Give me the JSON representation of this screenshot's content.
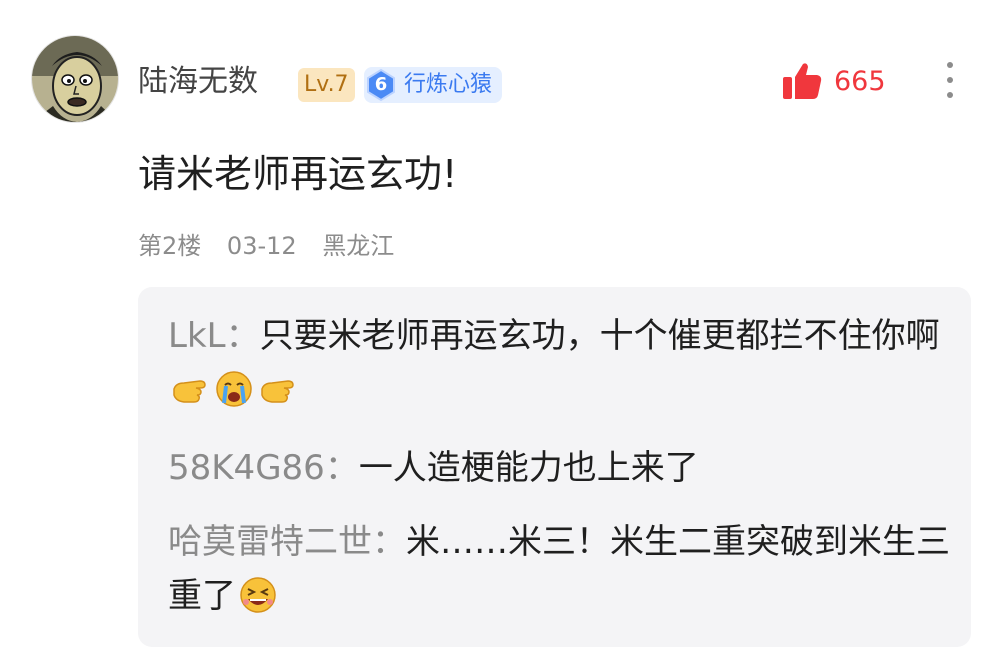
{
  "post": {
    "username": "陆海无数",
    "level": "Lv.7",
    "rank_number": "6",
    "rank_title": "行炼心猿",
    "like_count": "665",
    "comment_text": "请米老师再运玄功!",
    "floor": "第2楼",
    "date": "03-12",
    "location": "黑龙江"
  },
  "replies": [
    {
      "name": "LkL",
      "separator": "：",
      "text": "只要米老师再运玄功，十个催更都拦不住你啊",
      "emojis": [
        "hand-left-icon",
        "crying-face-icon",
        "hand-left-icon"
      ]
    },
    {
      "name": "58K4G86",
      "separator": "：",
      "text": "一人造梗能力也上来了",
      "emojis": []
    },
    {
      "name": "哈莫雷特二世",
      "separator": "：",
      "text": "米……米三！米生二重突破到米生三重了",
      "emojis": [
        "laughing-face-icon"
      ]
    }
  ],
  "colors": {
    "like_red": "#f0373d",
    "level_bg": "#fbe6bf",
    "level_text": "#b06f12",
    "rank_bg": "#e5efff",
    "rank_text": "#3a7af0",
    "reply_box_bg": "#f4f4f6",
    "reply_name": "#8a8a8a",
    "meta_text": "#8c8c8c"
  }
}
